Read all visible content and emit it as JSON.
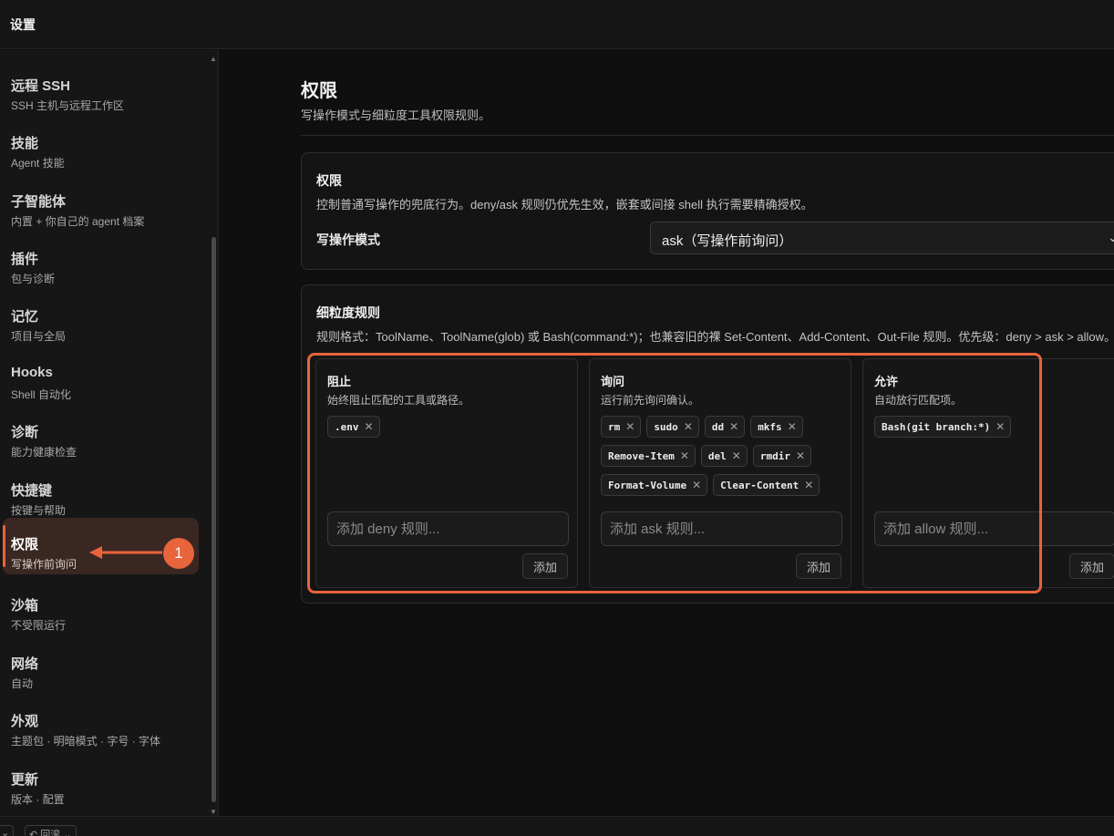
{
  "window": {
    "title": "设置"
  },
  "sidebar": {
    "items": [
      {
        "label": "远程 SSH",
        "sub": "SSH 主机与远程工作区"
      },
      {
        "label": "技能",
        "sub": "Agent 技能"
      },
      {
        "label": "子智能体",
        "sub": "内置 + 你自己的 agent 档案"
      },
      {
        "label": "插件",
        "sub": "包与诊断"
      },
      {
        "label": "记忆",
        "sub": "项目与全局"
      },
      {
        "label": "Hooks",
        "sub": "Shell 自动化"
      },
      {
        "label": "诊断",
        "sub": "能力健康检查"
      },
      {
        "label": "快捷键",
        "sub": "按键与帮助"
      },
      {
        "label": "权限",
        "sub": "写操作前询问"
      },
      {
        "label": "沙箱",
        "sub": "不受限运行"
      },
      {
        "label": "网络",
        "sub": "自动"
      },
      {
        "label": "外观",
        "sub": "主题包 · 明暗模式 · 字号 · 字体"
      },
      {
        "label": "更新",
        "sub": "版本 · 配置"
      }
    ],
    "active_index": 8
  },
  "bottombar": {
    "left_label": "⌄",
    "rollback_label": "↶ 回滚 ⌄"
  },
  "page": {
    "title": "权限",
    "description": "写操作模式与细粒度工具权限规则。"
  },
  "permissions_card": {
    "title": "权限",
    "description": "控制普通写操作的兜底行为。deny/ask 规则仍优先生效，嵌套或间接 shell 执行需要精确授权。",
    "mode_label": "写操作模式",
    "mode_value": "ask（写操作前询问）"
  },
  "rules_card": {
    "title": "细粒度规则",
    "description": "规则格式：ToolName、ToolName(glob) 或 Bash(command:*)；也兼容旧的裸 Set-Content、Add-Content、Out-File 规则。优先级：deny > ask > allow。",
    "deny": {
      "title": "阻止",
      "description": "始终阻止匹配的工具或路径。",
      "chips": [
        ".env"
      ],
      "placeholder": "添加 deny 规则...",
      "add_label": "添加"
    },
    "ask": {
      "title": "询问",
      "description": "运行前先询问确认。",
      "chips": [
        "rm",
        "sudo",
        "dd",
        "mkfs",
        "Remove-Item",
        "del",
        "rmdir",
        "Format-Volume",
        "Clear-Content"
      ],
      "placeholder": "添加 ask 规则...",
      "add_label": "添加"
    },
    "allow": {
      "title": "允许",
      "description": "自动放行匹配项。",
      "chips": [
        "Bash(git branch:*)"
      ],
      "placeholder": "添加 allow 规则...",
      "add_label": "添加"
    }
  },
  "annotation": {
    "badge": "1",
    "color": "#e8643a"
  },
  "icons": {
    "chip_remove": "close-icon",
    "select_chevron": "chevron-down-icon"
  }
}
